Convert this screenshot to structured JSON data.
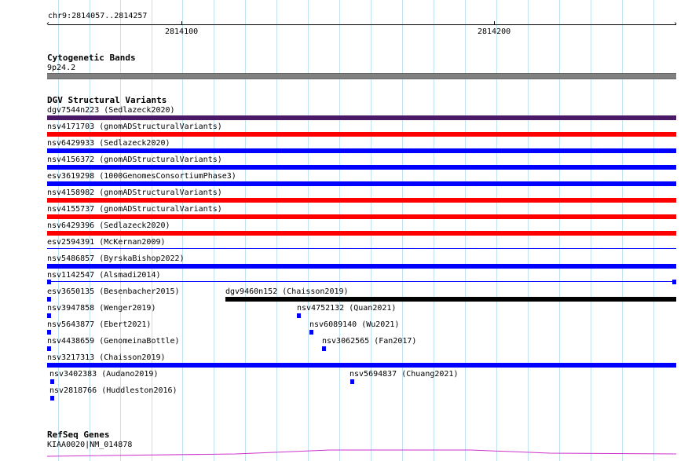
{
  "ruler": {
    "region": "chr9:2814057..2814257",
    "tick_labels": [
      "2814100",
      "2814200"
    ]
  },
  "colors": {
    "gray": "#808080",
    "purple": "#4b1a66",
    "red": "#ff0000",
    "blue": "#0000ff",
    "black": "#000000",
    "grid": "#bfe3f0",
    "gene": "#cc33cc"
  },
  "tracks": {
    "cytoband": {
      "title": "Cytogenetic Bands",
      "feature": "9p24.2"
    },
    "dgv": {
      "title": "DGV Structural Variants",
      "features": [
        {
          "label": "dgv7544n223 (Sedlazeck2020)",
          "color": "purple"
        },
        {
          "label": "nsv4171703 (gnomADStructuralVariants)",
          "color": "red"
        },
        {
          "label": "nsv6429933 (Sedlazeck2020)",
          "color": "blue"
        },
        {
          "label": "nsv4156372 (gnomADStructuralVariants)",
          "color": "blue"
        },
        {
          "label": "esv3619298 (1000GenomesConsortiumPhase3)",
          "color": "blue"
        },
        {
          "label": "nsv4158982 (gnomADStructuralVariants)",
          "color": "red"
        },
        {
          "label": "nsv4155737 (gnomADStructuralVariants)",
          "color": "red"
        },
        {
          "label": "nsv6429396 (Sedlazeck2020)",
          "color": "red"
        },
        {
          "label": "esv2594391 (McKernan2009)",
          "color": "blue"
        },
        {
          "label": "nsv5486857 (ByrskaBishop2022)",
          "color": "blue"
        },
        {
          "label": "nsv1142547 (Alsmadi2014)",
          "color": "blue"
        },
        {
          "label": "esv3650135 (Besenbacher2015)",
          "color": "blue"
        },
        {
          "label": "dgv9460n152 (Chaisson2019)",
          "color": "black"
        },
        {
          "label": "nsv3947858 (Wenger2019)",
          "color": "blue"
        },
        {
          "label": "nsv4752132 (Quan2021)",
          "color": "blue"
        },
        {
          "label": "nsv5643877 (Ebert2021)",
          "color": "blue"
        },
        {
          "label": "nsv6089140 (Wu2021)",
          "color": "blue"
        },
        {
          "label": "nsv4438659 (GenomeinaBottle)",
          "color": "blue"
        },
        {
          "label": "nsv3062565 (Fan2017)",
          "color": "blue"
        },
        {
          "label": "nsv3217313 (Chaisson2019)",
          "color": "blue"
        },
        {
          "label": "nsv3402383 (Audano2019)",
          "color": "blue"
        },
        {
          "label": "nsv5694837 (Chuang2021)",
          "color": "blue"
        },
        {
          "label": "nsv2818766 (Huddleston2016)",
          "color": "blue"
        }
      ]
    },
    "refseq": {
      "title": "RefSeq Genes",
      "feature": "KIAA0020|NM_014878"
    }
  }
}
